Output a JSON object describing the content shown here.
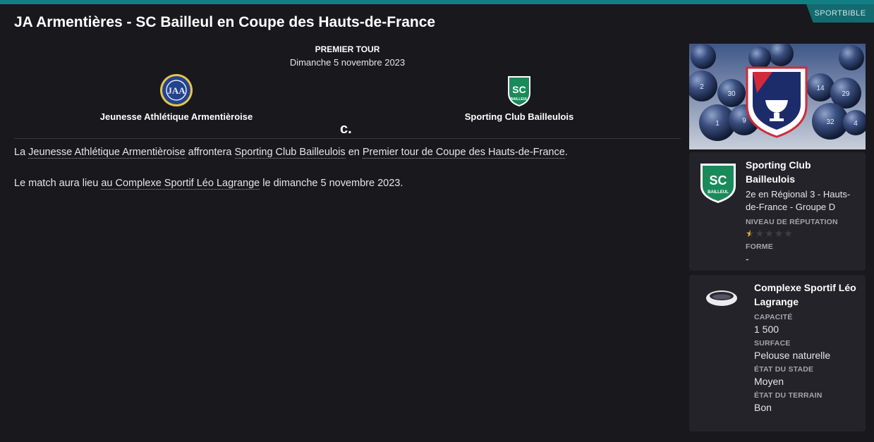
{
  "header": {
    "title": "JA Armentières - SC Bailleul en Coupe des Hauts-de-France",
    "brand": "SPORTBIBLE"
  },
  "match": {
    "round": "PREMIER TOUR",
    "date": "Dimanche 5 novembre 2023",
    "versus": "c.",
    "home": {
      "name": "Jeunesse Athlétique Armentièroise",
      "logo_text": "JAA"
    },
    "away": {
      "name": "Sporting Club Bailleulois",
      "logo_text": "SC",
      "logo_subtext": "BAILLEUL"
    }
  },
  "description": {
    "p1": {
      "t1": "La ",
      "l1": "Jeunesse Athlétique Armentièroise",
      "t2": " affrontera ",
      "l2": "Sporting Club Bailleulois",
      "t3": " en ",
      "l3": "Premier tour de Coupe des Hauts-de-France",
      "t4": "."
    },
    "p2": {
      "t1": "Le match aura lieu ",
      "l1": "au Complexe Sportif Léo Lagrange",
      "t2": " le dimanche 5 novembre 2023."
    }
  },
  "sidebar": {
    "promo_numbers": [
      "2",
      "30",
      "1",
      "9",
      "14",
      "29",
      "32",
      "4"
    ],
    "club": {
      "name": "Sporting Club Bailleulois",
      "position": "2e en Régional 3 - Hauts-de-France - Groupe D",
      "reputation_label": "NIVEAU DE RÉPUTATION",
      "reputation_stars": 0.5,
      "reputation_max": 5,
      "form_label": "FORME",
      "form_value": "-"
    },
    "stadium": {
      "name": "Complexe Sportif Léo Lagrange",
      "capacity_label": "CAPACITÉ",
      "capacity": "1 500",
      "surface_label": "SURFACE",
      "surface": "Pelouse naturelle",
      "stadium_state_label": "ÉTAT DU STADE",
      "stadium_state": "Moyen",
      "pitch_state_label": "ÉTAT DU TERRAIN",
      "pitch_state": "Bon"
    }
  },
  "colors": {
    "background": "#19181d",
    "card": "#242329",
    "accent": "#127f84",
    "away_green": "#1b8a5a",
    "home_blue": "#22438e",
    "home_yellow": "#e7c44a",
    "star_gold": "#e8b43a"
  }
}
